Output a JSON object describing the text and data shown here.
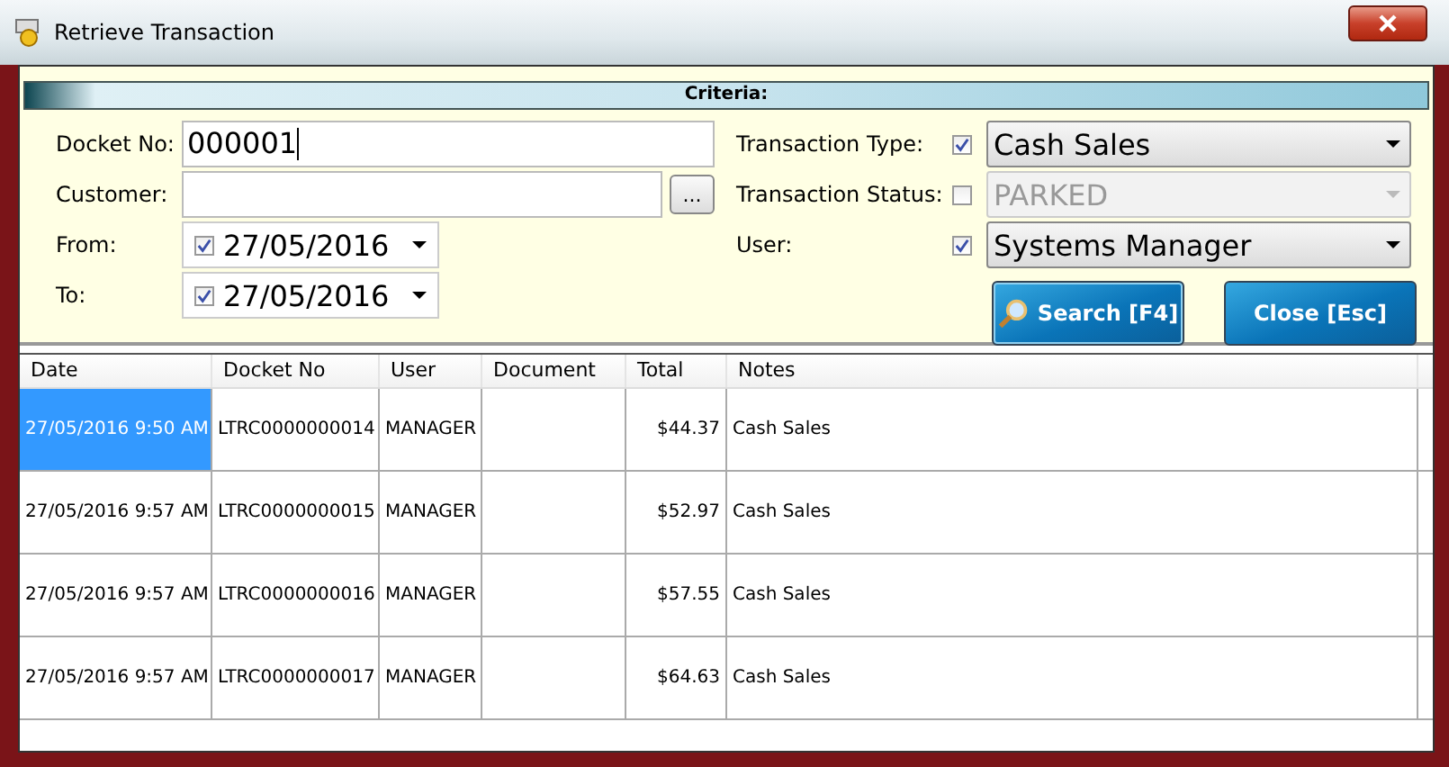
{
  "window": {
    "title": "Retrieve Transaction"
  },
  "criteria": {
    "title": "Criteria:",
    "left": [
      {
        "kind": "text",
        "label": "Docket No:",
        "value": "000001",
        "focused": true
      },
      {
        "kind": "lookup",
        "label": "Customer:",
        "button": "..."
      },
      {
        "kind": "date",
        "label": "From:",
        "checked": true,
        "value": "27/05/2016"
      },
      {
        "kind": "date",
        "label": "To:",
        "checked": true,
        "value": "27/05/2016"
      }
    ],
    "right": [
      {
        "label": "Transaction Type:",
        "checked": true,
        "value": "Cash Sales",
        "disabled": false
      },
      {
        "label": "Transaction Status:",
        "checked": false,
        "value": "PARKED",
        "disabled": true
      },
      {
        "label": "User:",
        "checked": true,
        "value": "Systems Manager",
        "disabled": false
      }
    ],
    "buttons": [
      {
        "kind": "search",
        "label": "Search [F4]"
      },
      {
        "kind": "plain",
        "label": "Close [Esc]"
      }
    ]
  },
  "table": {
    "columns": [
      "Date",
      "Docket No",
      "User",
      "Document",
      "Total",
      "Notes"
    ],
    "rows": [
      {
        "selected": true,
        "cells": [
          "27/05/2016 9:50 AM",
          "LTRC0000000014",
          "MANAGER",
          "",
          "$44.37",
          "Cash Sales"
        ]
      },
      {
        "selected": false,
        "cells": [
          "27/05/2016 9:57 AM",
          "LTRC0000000015",
          "MANAGER",
          "",
          "$52.97",
          "Cash Sales"
        ]
      },
      {
        "selected": false,
        "cells": [
          "27/05/2016 9:57 AM",
          "LTRC0000000016",
          "MANAGER",
          "",
          "$57.55",
          "Cash Sales"
        ]
      },
      {
        "selected": false,
        "cells": [
          "27/05/2016 9:57 AM",
          "LTRC0000000017",
          "MANAGER",
          "",
          "$64.63",
          "Cash Sales"
        ]
      }
    ]
  }
}
